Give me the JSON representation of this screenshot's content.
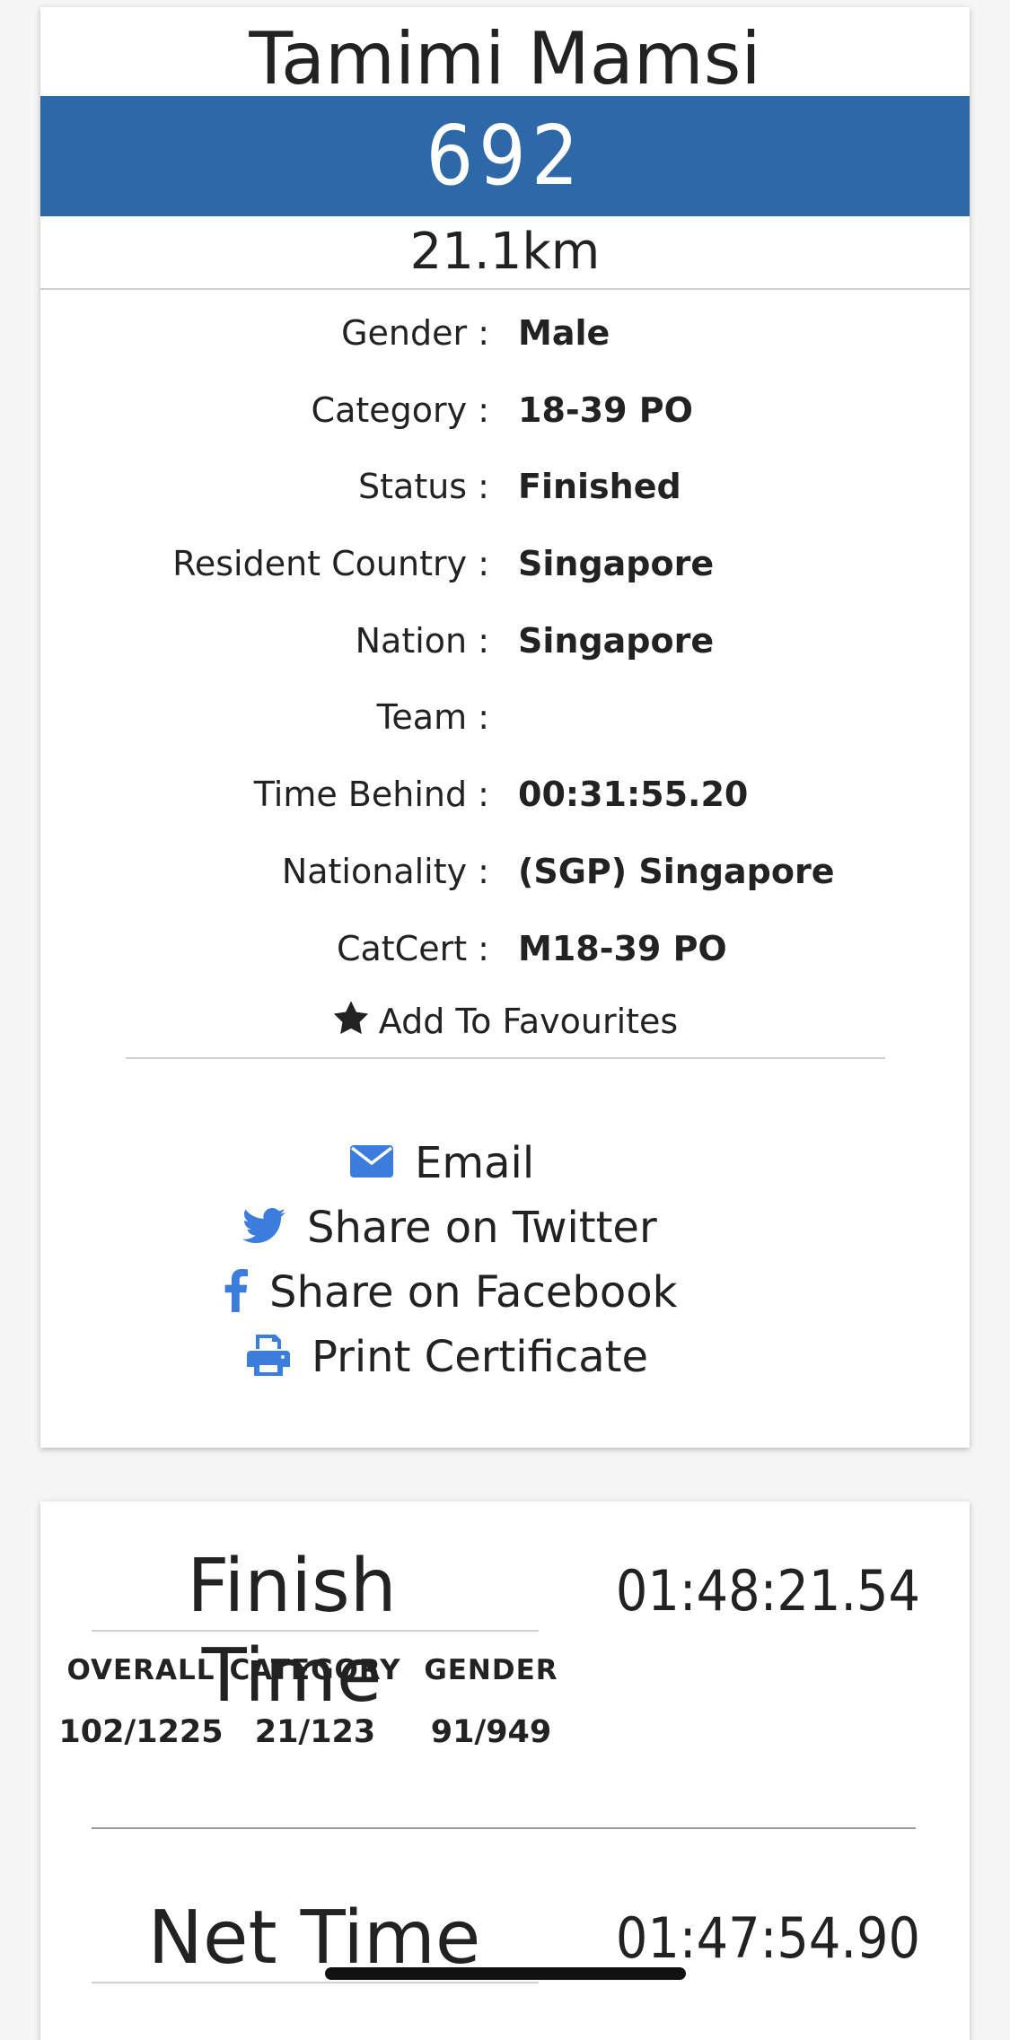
{
  "runner": {
    "name": "Tamimi Mamsi",
    "bib": "692",
    "distance": "21.1km"
  },
  "details": [
    {
      "label": "Gender :",
      "value": "Male"
    },
    {
      "label": "Category :",
      "value": "18-39 PO"
    },
    {
      "label": "Status :",
      "value": "Finished"
    },
    {
      "label": "Resident Country :",
      "value": "Singapore"
    },
    {
      "label": "Nation :",
      "value": "Singapore"
    },
    {
      "label": "Team :",
      "value": ""
    },
    {
      "label": "Time Behind :",
      "value": "00:31:55.20"
    },
    {
      "label": "Nationality :",
      "value": "(SGP) Singapore"
    },
    {
      "label": "CatCert :",
      "value": "M18-39 PO"
    }
  ],
  "favourite": {
    "label": "Add To Favourites",
    "icon": "star-icon"
  },
  "share": [
    {
      "label": "Email",
      "icon": "envelope-icon"
    },
    {
      "label": "Share on Twitter",
      "icon": "twitter-icon"
    },
    {
      "label": "Share on Facebook",
      "icon": "facebook-icon"
    },
    {
      "label": "Print Certificate",
      "icon": "printer-icon"
    }
  ],
  "finish": {
    "title": "Finish Time",
    "time": "01:48:21.54",
    "ranks": [
      {
        "head": "OVERALL",
        "value": "102/1225"
      },
      {
        "head": "CATEGORY",
        "value": "21/123"
      },
      {
        "head": "GENDER",
        "value": "91/949"
      }
    ]
  },
  "net": {
    "title": "Net Time",
    "time": "01:47:54.90"
  },
  "colors": {
    "bib_bar": "#2d68a8",
    "icon_blue": "#3b7ddd",
    "background": "#f5f5f5"
  }
}
